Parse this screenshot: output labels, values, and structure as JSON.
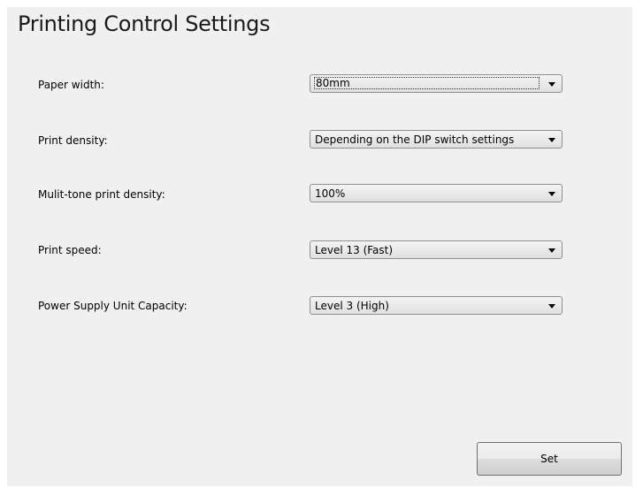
{
  "page": {
    "title": "Printing Control Settings"
  },
  "settings": [
    {
      "label": "Paper width:",
      "value": "80mm"
    },
    {
      "label": "Print density:",
      "value": "Depending on the DIP switch settings"
    },
    {
      "label": "Mulit-tone print density:",
      "value": "100%"
    },
    {
      "label": "Print speed:",
      "value": "Level 13 (Fast)"
    },
    {
      "label": "Power Supply Unit Capacity:",
      "value": "Level 3 (High)"
    }
  ],
  "actions": {
    "set_label": "Set"
  },
  "icons": {
    "dropdown": "chevron-down-icon"
  },
  "colors": {
    "panel_background": "#f0f0f0",
    "combo_border": "#8e8f8f"
  }
}
